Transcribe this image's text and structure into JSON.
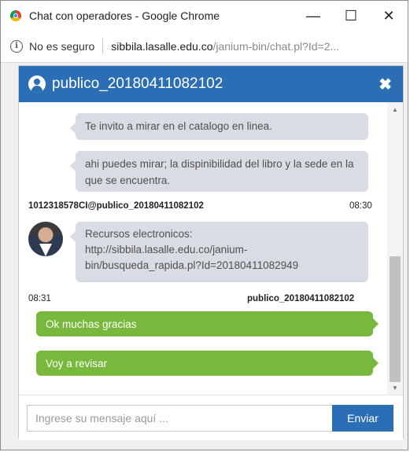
{
  "window": {
    "title": "Chat con operadores - Google Chrome",
    "minimize": "—",
    "maximize": "☐",
    "close": "✕"
  },
  "address": {
    "security_label": "No es seguro",
    "url_host": "sibbila.lasalle.edu.co",
    "url_path": "/janium-bin/chat.pl?Id=2..."
  },
  "chat": {
    "title": "publico_20180411082102",
    "close_label": "✖",
    "messages": [
      {
        "text": "Te invito a mirar en el catalogo en linea."
      },
      {
        "text": "ahi puedes mirar; la dispinibilidad del libro y la sede en la que se encuentra."
      },
      {
        "sender": "1012318578CI@publico_20180411082102",
        "time": "08:30",
        "text_line1": "Recursos electronicos:",
        "text_line2": "http://sibbila.lasalle.edu.co/janium-",
        "text_line3": "bin/busqueda_rapida.pl?Id=20180411082949"
      },
      {
        "time": "08:31",
        "sender": "publico_20180411082102",
        "text": "Ok muchas gracias"
      },
      {
        "text": "Voy a revisar"
      }
    ],
    "input_placeholder": "Ingrese su mensaje aquí ...",
    "send_label": "Enviar"
  },
  "colors": {
    "header_blue": "#2c6eb5",
    "operator_bubble": "#d9dde3",
    "user_bubble": "#78b83c"
  }
}
